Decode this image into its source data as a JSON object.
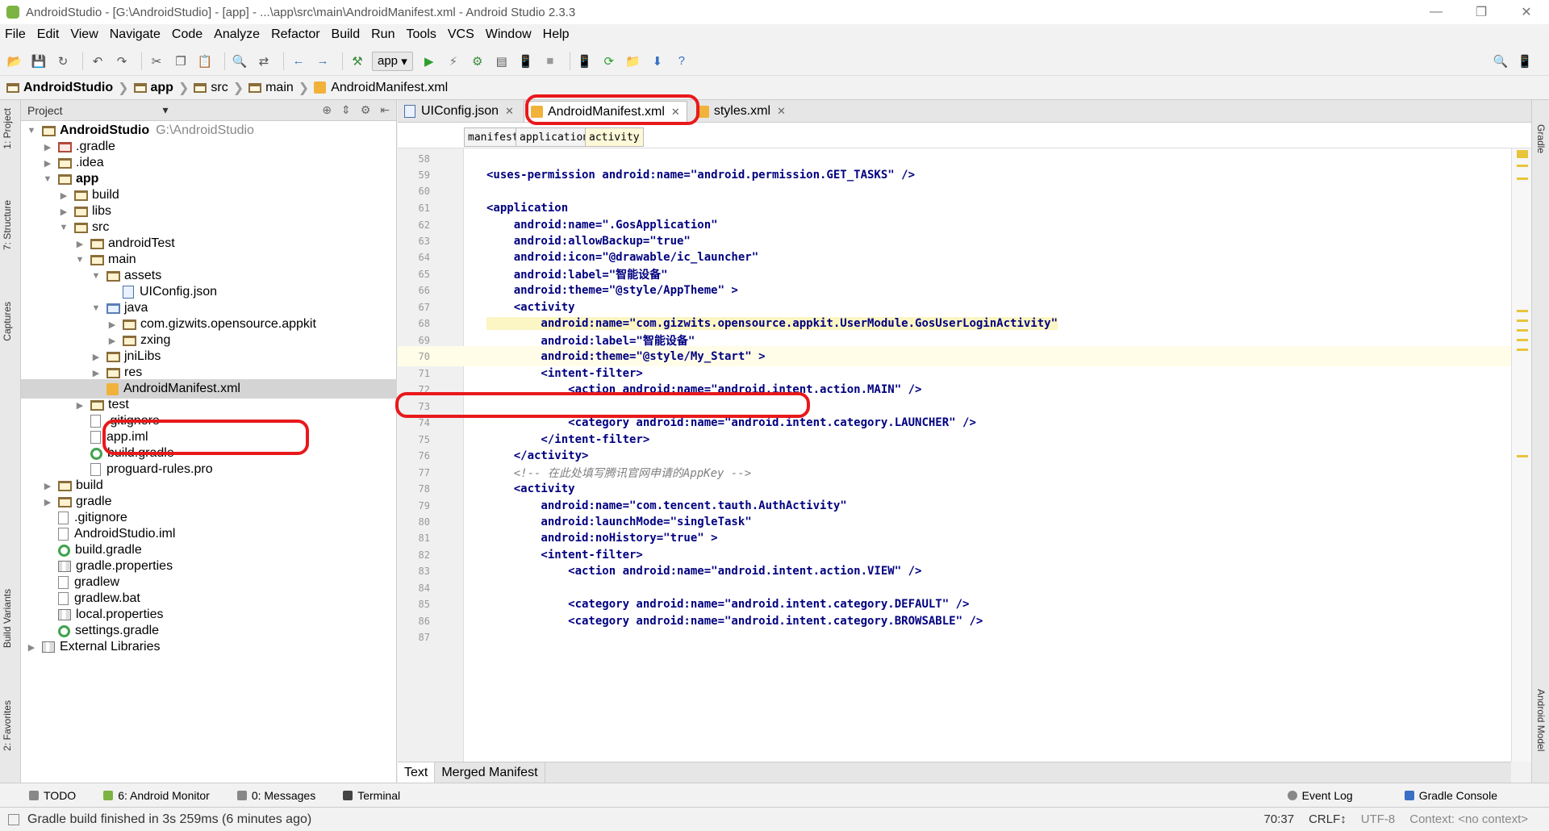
{
  "window": {
    "title": "AndroidStudio - [G:\\AndroidStudio] - [app] - ...\\app\\src\\main\\AndroidManifest.xml - Android Studio 2.3.3"
  },
  "menu": [
    "File",
    "Edit",
    "View",
    "Navigate",
    "Code",
    "Analyze",
    "Refactor",
    "Build",
    "Run",
    "Tools",
    "VCS",
    "Window",
    "Help"
  ],
  "toolbar": {
    "run_config": "app"
  },
  "nav": {
    "crumbs": [
      "AndroidStudio",
      "app",
      "src",
      "main",
      "AndroidManifest.xml"
    ]
  },
  "left_tabs": [
    "1: Project",
    "7: Structure",
    "Captures",
    "Build Variants",
    "2: Favorites"
  ],
  "right_tabs": [
    "Gradle",
    "Android Model"
  ],
  "project": {
    "header": "Project",
    "root_name": "AndroidStudio",
    "root_path": "G:\\AndroidStudio",
    "tree": [
      ".gradle",
      ".idea",
      "app",
      "build",
      "libs",
      "src",
      "androidTest",
      "main",
      "assets",
      "UIConfig.json",
      "java",
      "com.gizwits.opensource.appkit",
      "zxing",
      "jniLibs",
      "res",
      "AndroidManifest.xml",
      "test",
      ".gitignore",
      "app.iml",
      "build.gradle",
      "proguard-rules.pro",
      "build",
      "gradle",
      ".gitignore",
      "AndroidStudio.iml",
      "build.gradle",
      "gradle.properties",
      "gradlew",
      "gradlew.bat",
      "local.properties",
      "settings.gradle",
      "External Libraries"
    ]
  },
  "editor": {
    "tabs": [
      "UIConfig.json",
      "AndroidManifest.xml",
      "styles.xml"
    ],
    "xml_breadcrumb": [
      "manifest",
      "application",
      "activity"
    ],
    "line_numbers": [
      "58",
      "59",
      "60",
      "61",
      "62",
      "63",
      "64",
      "65",
      "66",
      "67",
      "68",
      "69",
      "70",
      "71",
      "72",
      "73",
      "74",
      "75",
      "76",
      "77",
      "78",
      "79",
      "80",
      "81",
      "82",
      "83",
      "84",
      "85",
      "86",
      "87"
    ],
    "lines": [
      "",
      "<uses-permission android:name=\"android.permission.GET_TASKS\" />",
      "",
      "<application",
      "    android:name=\".GosApplication\"",
      "    android:allowBackup=\"true\"",
      "    android:icon=\"@drawable/ic_launcher\"",
      "    android:label=\"智能设备\"",
      "    android:theme=\"@style/AppTheme\" >",
      "    <activity",
      "        android:name=\"com.gizwits.opensource.appkit.UserModule.GosUserLoginActivity\"",
      "        android:label=\"智能设备\"",
      "        android:theme=\"@style/My_Start\" >",
      "        <intent-filter>",
      "            <action android:name=\"android.intent.action.MAIN\" />",
      "",
      "            <category android:name=\"android.intent.category.LAUNCHER\" />",
      "        </intent-filter>",
      "    </activity>",
      "    <!-- 在此处填写腾讯官网申请的AppKey -->",
      "    <activity",
      "        android:name=\"com.tencent.tauth.AuthActivity\"",
      "        android:launchMode=\"singleTask\"",
      "        android:noHistory=\"true\" >",
      "        <intent-filter>",
      "            <action android:name=\"android.intent.action.VIEW\" />",
      "",
      "            <category android:name=\"android.intent.category.DEFAULT\" />",
      "            <category android:name=\"android.intent.category.BROWSABLE\" />",
      ""
    ],
    "bottom_tabs": [
      "Text",
      "Merged Manifest"
    ]
  },
  "tool_windows": [
    "TODO",
    "6: Android Monitor",
    "0: Messages",
    "Terminal"
  ],
  "tool_windows_right": [
    "Event Log",
    "Gradle Console"
  ],
  "status": {
    "message": "Gradle build finished in 3s 259ms (6 minutes ago)",
    "position": "70:37",
    "line_sep": "CRLF↕",
    "encoding": "UTF-8",
    "context": "Context: <no context>"
  }
}
